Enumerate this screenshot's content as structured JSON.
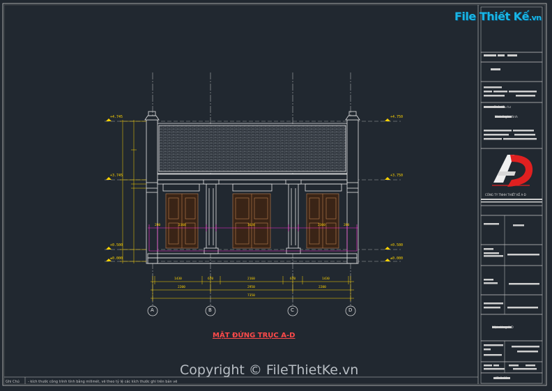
{
  "watermark": {
    "logo_text": "File Thiết Kế",
    "logo_domain": ".vn",
    "copyright": "Copyright © FileThietKe.vn"
  },
  "drawing": {
    "title": "MẶT ĐỨNG TRỤC A-D",
    "axis_labels": [
      "A",
      "B",
      "C",
      "D"
    ],
    "level_marks_left": [
      "+4.745",
      "+3.745",
      "+0.500",
      "±0.000"
    ],
    "level_marks_right": [
      "+4.750",
      "+3.750",
      "+0.500",
      "±0.000"
    ],
    "dim_bottom_row1": [
      "1430",
      "670",
      "2160",
      "670",
      "1430"
    ],
    "dim_bottom_row2": [
      "2200",
      "2950",
      "2200"
    ],
    "dim_bottom_total": "7350",
    "dim_inner": [
      "280",
      "2360",
      "1620",
      "2360",
      "280"
    ]
  },
  "notes": {
    "label": "Ghi Chú",
    "text": "- kích thước công trình tính bằng milimét, vẽ theo tỷ lệ các kích thước ghi trên bản vẽ"
  },
  "title_block": {
    "sheet_code": "KT: 1-03",
    "panel_label_1": "Chủ đầu tư",
    "panel_label_2": "Nhà ở gia đình",
    "panel_label_3": "Mặt đứng A-D",
    "company_tag": "CÔNG TY TNHH THIẾT KẾ A-D"
  },
  "colors": {
    "background": "#212830",
    "line": "#e8e8e8",
    "dimension": "#ffd400",
    "magenta": "#ff2bd6",
    "brick": "#4a4f55",
    "door": "#6b3a1e",
    "title": "#ff4a4a",
    "logo": "#19b5e6"
  }
}
